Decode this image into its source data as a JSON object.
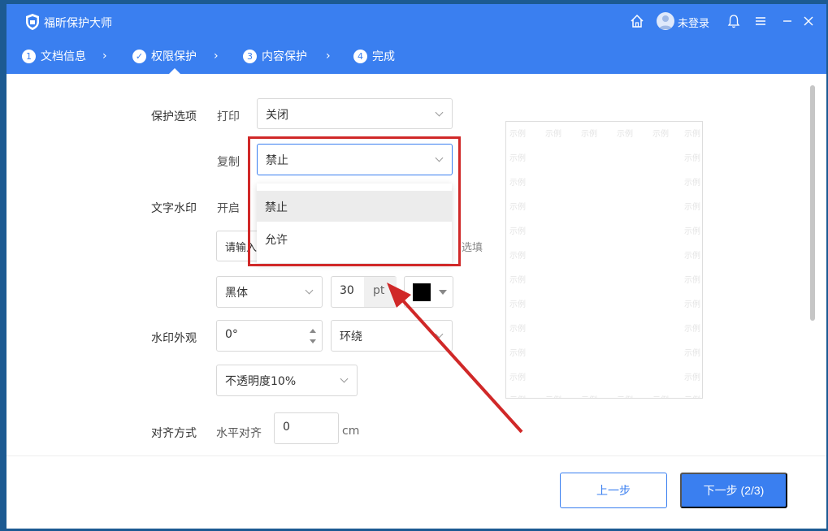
{
  "app": {
    "title": "福昕保护大师",
    "user_label": "未登录"
  },
  "steps": [
    {
      "num": "1",
      "label": "文档信息"
    },
    {
      "num": "✓",
      "label": "权限保护"
    },
    {
      "num": "3",
      "label": "内容保护"
    },
    {
      "num": "4",
      "label": "完成"
    }
  ],
  "form": {
    "protect_options_label": "保护选项",
    "print_label": "打印",
    "print_value": "关闭",
    "copy_label": "复制",
    "copy_value": "禁止",
    "copy_options": [
      "禁止",
      "允许"
    ],
    "text_watermark_label": "文字水印",
    "watermark_enable_label": "开启",
    "watermark_text_placeholder": "请输入",
    "optional_hint": "选填",
    "font_value": "黑体",
    "font_size_value": "30",
    "font_size_unit": "pt",
    "font_color": "#000000",
    "watermark_appearance_label": "水印外观",
    "rotation_value": "0°",
    "layout_value": "环绕",
    "opacity_value": "不透明度10%",
    "alignment_label": "对齐方式",
    "horizontal_align_label": "水平对齐",
    "horizontal_align_value": "0",
    "horizontal_align_unit": "cm"
  },
  "preview": {
    "watermark_text": "示例"
  },
  "footer": {
    "prev_label": "上一步",
    "next_label": "下一步 (2/3)"
  },
  "colors": {
    "brand": "#3a7ff0",
    "highlight": "#d02828"
  }
}
